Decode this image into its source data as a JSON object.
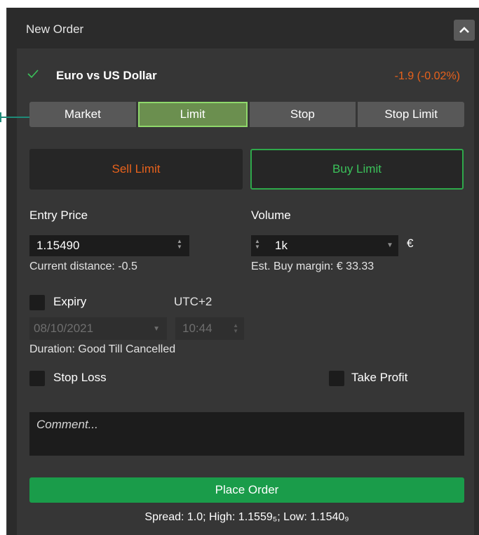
{
  "window": {
    "title": "New Order"
  },
  "instrument": {
    "name": "Euro vs US Dollar",
    "change": "-1.9 (-0.02%)"
  },
  "order_types": [
    {
      "label": "Market",
      "active": false
    },
    {
      "label": "Limit",
      "active": true
    },
    {
      "label": "Stop",
      "active": false
    },
    {
      "label": "Stop Limit",
      "active": false
    }
  ],
  "sides": {
    "sell_label": "Sell Limit",
    "buy_label": "Buy Limit"
  },
  "entry": {
    "label": "Entry Price",
    "value": "1.15490",
    "distance": "Current distance: -0.5"
  },
  "volume": {
    "label": "Volume",
    "value": "1k",
    "currency": "€",
    "margin": "Est. Buy margin: € 33.33"
  },
  "expiry": {
    "label": "Expiry",
    "timezone": "UTC+2",
    "date": "08/10/2021",
    "time": "10:44",
    "duration": "Duration: Good Till Cancelled"
  },
  "protection": {
    "stop_loss_label": "Stop Loss",
    "take_profit_label": "Take Profit"
  },
  "comment": {
    "placeholder": "Comment..."
  },
  "actions": {
    "place_order_label": "Place Order"
  },
  "footer": {
    "spread_text": "Spread: 1.0; High: 1.1559₅; Low: 1.1540₉"
  },
  "colors": {
    "sell": "#e8621c",
    "buy": "#3bc25a",
    "accent": "#1a9c4a",
    "active_tab": "#6b8f4f"
  }
}
